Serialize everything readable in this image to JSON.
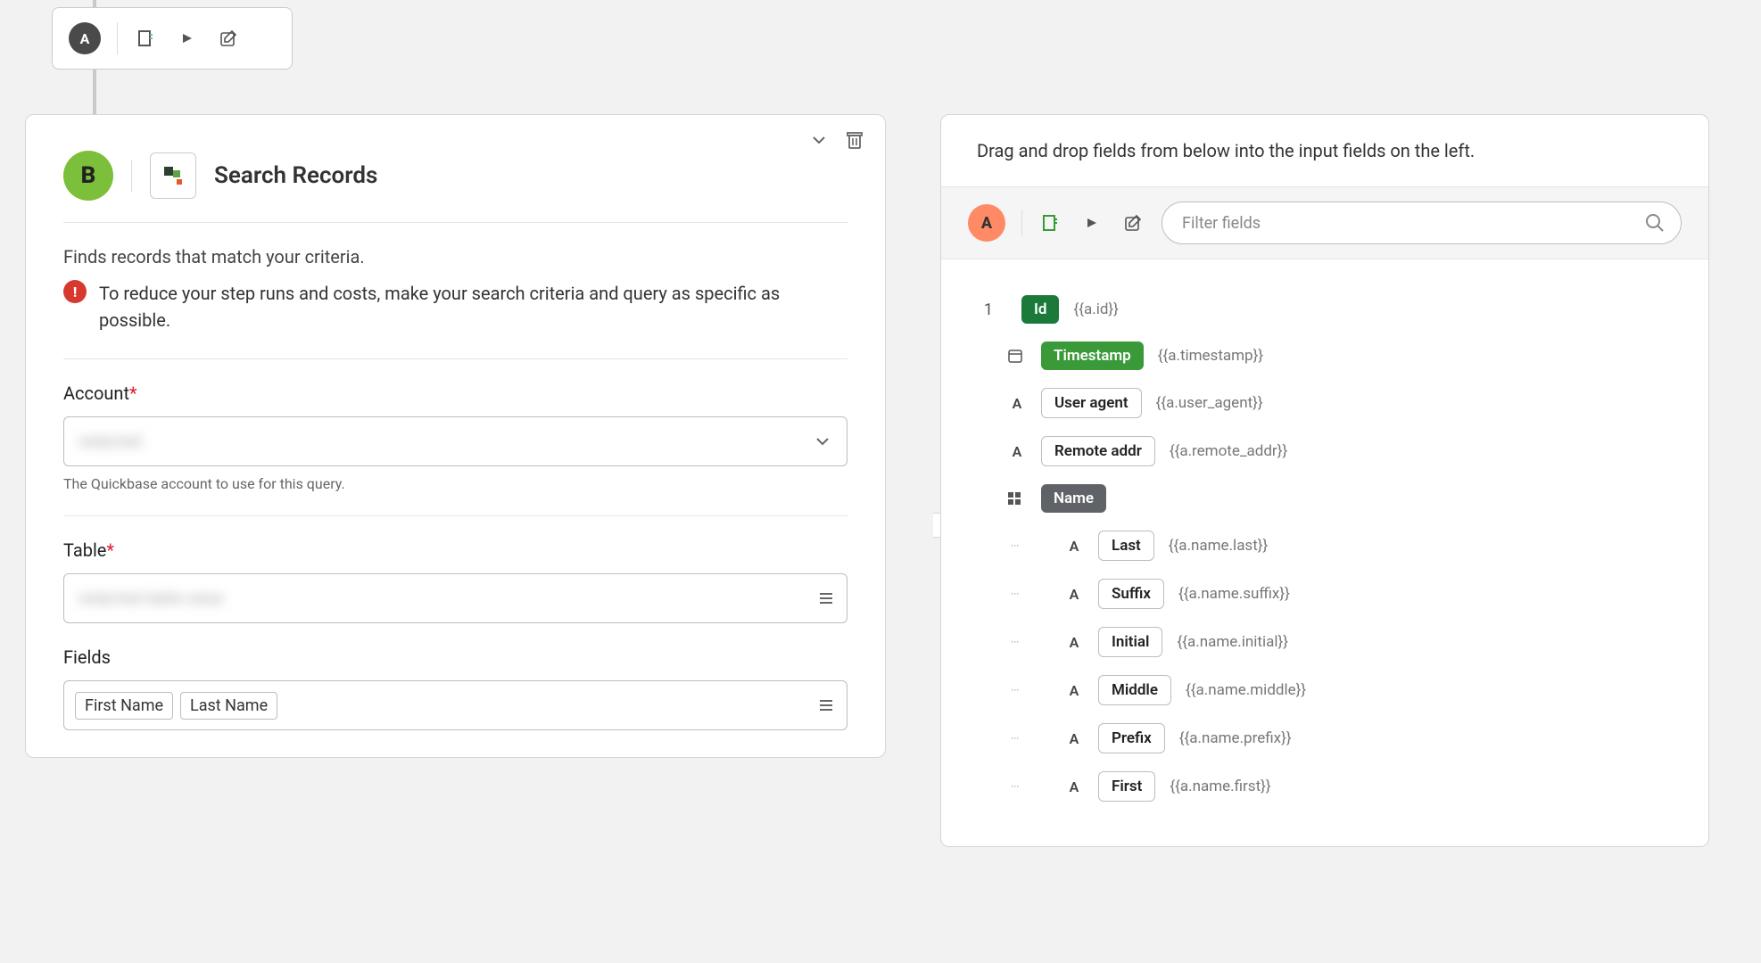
{
  "topNode": {
    "badge": "A"
  },
  "leftPanel": {
    "badge": "B",
    "title": "Search Records",
    "description": "Finds records that match your criteria.",
    "warning": "To reduce your step runs and costs, make your search criteria and query as specific as possible.",
    "account": {
      "label": "Account",
      "value": "redacted",
      "helper": "The Quickbase account to use for this query."
    },
    "table": {
      "label": "Table",
      "value": "redacted-table-value"
    },
    "fields": {
      "label": "Fields",
      "chips": [
        "First Name",
        "Last Name"
      ]
    }
  },
  "rightPanel": {
    "instruction": "Drag and drop fields from below into the input fields on the left.",
    "badge": "A",
    "filterPlaceholder": "Filter fields",
    "fields": [
      {
        "num": "1",
        "type": "id",
        "label": "Id",
        "expr": "{{a.id}}",
        "style": "green-dark",
        "nested": false
      },
      {
        "num": "",
        "type": "date",
        "label": "Timestamp",
        "expr": "{{a.timestamp}}",
        "style": "green",
        "nested": false
      },
      {
        "num": "",
        "type": "text",
        "label": "User agent",
        "expr": "{{a.user_agent}}",
        "style": "outline",
        "nested": false
      },
      {
        "num": "",
        "type": "text",
        "label": "Remote addr",
        "expr": "{{a.remote_addr}}",
        "style": "outline",
        "nested": false
      },
      {
        "num": "",
        "type": "object",
        "label": "Name",
        "expr": "",
        "style": "gray",
        "nested": false
      },
      {
        "num": "",
        "type": "text",
        "label": "Last",
        "expr": "{{a.name.last}}",
        "style": "outline",
        "nested": true
      },
      {
        "num": "",
        "type": "text",
        "label": "Suffix",
        "expr": "{{a.name.suffix}}",
        "style": "outline",
        "nested": true
      },
      {
        "num": "",
        "type": "text",
        "label": "Initial",
        "expr": "{{a.name.initial}}",
        "style": "outline",
        "nested": true
      },
      {
        "num": "",
        "type": "text",
        "label": "Middle",
        "expr": "{{a.name.middle}}",
        "style": "outline",
        "nested": true
      },
      {
        "num": "",
        "type": "text",
        "label": "Prefix",
        "expr": "{{a.name.prefix}}",
        "style": "outline",
        "nested": true
      },
      {
        "num": "",
        "type": "text",
        "label": "First",
        "expr": "{{a.name.first}}",
        "style": "outline",
        "nested": true
      }
    ]
  }
}
